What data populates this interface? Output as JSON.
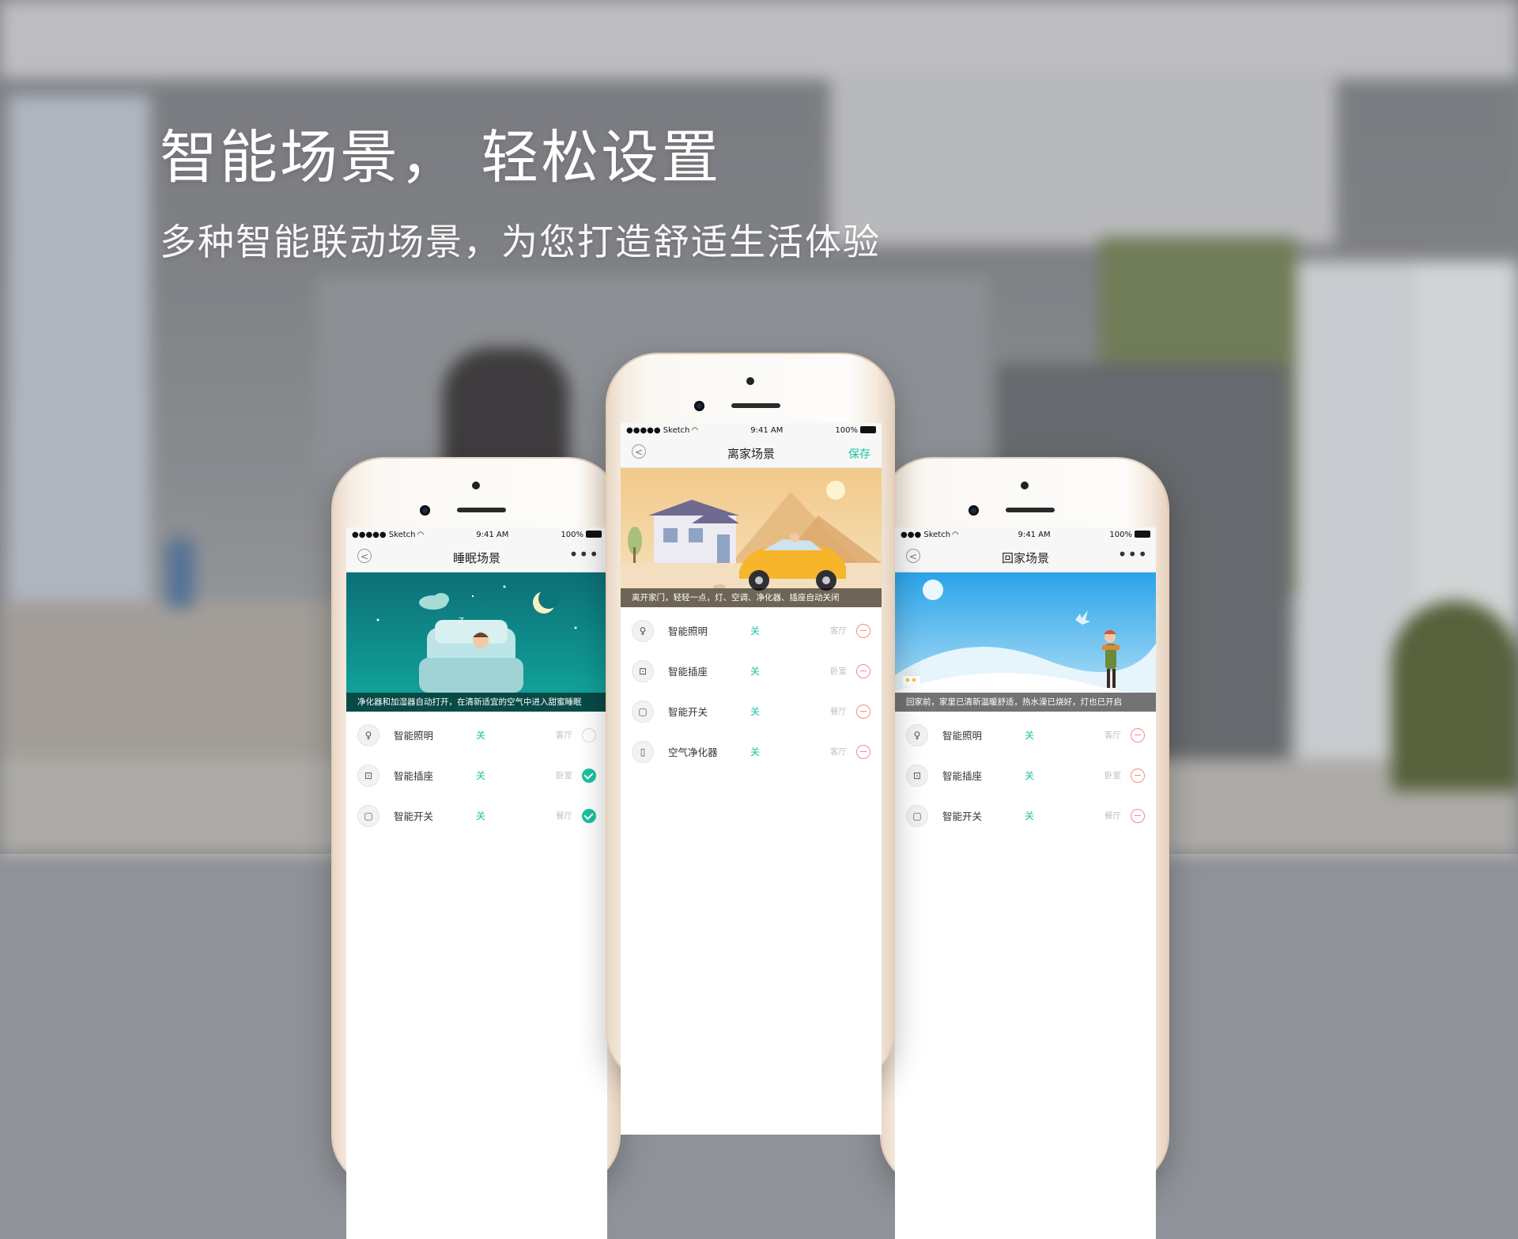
{
  "headline": "智能场景，  轻松设置",
  "subheadline": "多种智能联动场景，为您打造舒适生活体验",
  "colors": {
    "accent": "#19c2a1",
    "remove": "#f18a8a"
  },
  "phones": {
    "left": {
      "status": {
        "carrier": "●●●●● Sketch",
        "time": "9:41 AM",
        "battery": "100%"
      },
      "title": "睡眠场景",
      "right_action": "•••",
      "caption": "净化器和加湿器自动打开，在清新适宜的空气中进入甜蜜睡眠",
      "devices": [
        {
          "icon": "bulb-icon",
          "glyph": "♀",
          "name": "智能照明",
          "state": "关",
          "room": "客厅",
          "action": "unchecked"
        },
        {
          "icon": "socket-icon",
          "glyph": "⊡",
          "name": "智能插座",
          "state": "关",
          "room": "卧室",
          "action": "checked"
        },
        {
          "icon": "switch-icon",
          "glyph": "▢",
          "name": "智能开关",
          "state": "关",
          "room": "餐厅",
          "action": "checked"
        }
      ]
    },
    "center": {
      "status": {
        "carrier": "●●●●● Sketch",
        "time": "9:41 AM",
        "battery": "100%"
      },
      "title": "离家场景",
      "right_action": "保存",
      "caption": "离开家门，轻轻一点，灯、空调、净化器、插座自动关闭",
      "devices": [
        {
          "icon": "bulb-icon",
          "glyph": "♀",
          "name": "智能照明",
          "state": "关",
          "room": "客厅",
          "action": "remove"
        },
        {
          "icon": "socket-icon",
          "glyph": "⊡",
          "name": "智能插座",
          "state": "关",
          "room": "卧室",
          "action": "remove"
        },
        {
          "icon": "switch-icon",
          "glyph": "▢",
          "name": "智能开关",
          "state": "关",
          "room": "餐厅",
          "action": "remove"
        },
        {
          "icon": "purifier-icon",
          "glyph": "▯",
          "name": "空气净化器",
          "state": "关",
          "room": "客厅",
          "action": "remove"
        }
      ]
    },
    "right": {
      "status": {
        "carrier": "●●● Sketch",
        "time": "9:41 AM",
        "battery": "100%"
      },
      "title": "回家场景",
      "right_action": "•••",
      "caption": "回家前，家里已清新温暖舒适，热水澡已烧好，灯也已开启",
      "devices": [
        {
          "icon": "bulb-icon",
          "glyph": "♀",
          "name": "智能照明",
          "state": "关",
          "room": "客厅",
          "action": "remove"
        },
        {
          "icon": "socket-icon",
          "glyph": "⊡",
          "name": "智能插座",
          "state": "关",
          "room": "卧室",
          "action": "remove"
        },
        {
          "icon": "switch-icon",
          "glyph": "▢",
          "name": "智能开关",
          "state": "关",
          "room": "餐厅",
          "action": "remove"
        }
      ]
    }
  }
}
